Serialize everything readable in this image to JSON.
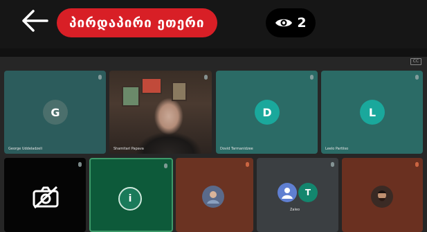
{
  "header": {
    "live_label": "პირდაპირი ეთერი",
    "viewer_count": "2",
    "colors": {
      "live_pill": "#d81f26",
      "viewer_pill": "#000000"
    }
  },
  "icons": {
    "back": "back-arrow-icon",
    "viewers": "eye-icon",
    "camera_off": "camera-off-icon",
    "captions": "captions-icon"
  },
  "participants": [
    {
      "initial": "G",
      "name": "George Uddeladzeli",
      "avatar_color": "#4b6f6c"
    },
    {
      "initial": "",
      "name": "Shamitari Papava",
      "avatar_color": ""
    },
    {
      "initial": "D",
      "name": "Dovid Tarmanidzee",
      "avatar_color": "#1aa89c"
    },
    {
      "initial": "L",
      "name": "Leelo Partiiso",
      "avatar_color": "#1aa89c"
    },
    {
      "initial": "",
      "name": "",
      "avatar_color": ""
    },
    {
      "initial": "i",
      "name": "",
      "avatar_color": "#1a7a5a"
    },
    {
      "initial": "",
      "name": "",
      "avatar_color": "#5a6a8a"
    },
    {
      "initial": "T",
      "name": "Zaleo",
      "avatar_color": "#13866e"
    },
    {
      "initial": "",
      "name": "",
      "avatar_color": "#3a2a24"
    }
  ]
}
